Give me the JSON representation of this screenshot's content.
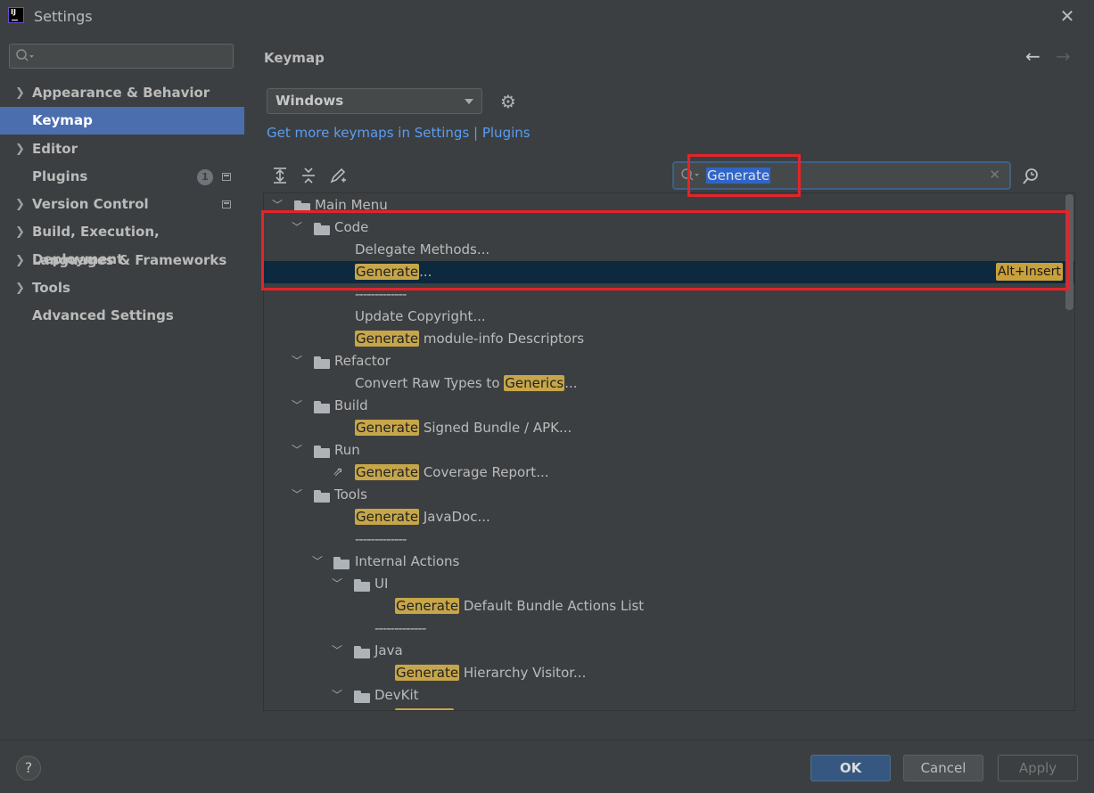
{
  "window": {
    "title": "Settings",
    "logo_text": "IJ"
  },
  "sidebar": {
    "search_placeholder": "",
    "items": [
      {
        "label": "Appearance & Behavior",
        "expandable": true
      },
      {
        "label": "Keymap",
        "selected": true
      },
      {
        "label": "Editor",
        "expandable": true
      },
      {
        "label": "Plugins",
        "badge": "1"
      },
      {
        "label": "Version Control",
        "expandable": true
      },
      {
        "label": "Build, Execution, Deployment",
        "expandable": true
      },
      {
        "label": "Languages & Frameworks",
        "expandable": true
      },
      {
        "label": "Tools",
        "expandable": true
      },
      {
        "label": "Advanced Settings"
      }
    ]
  },
  "main": {
    "title": "Keymap",
    "keymap_select": "Windows",
    "link_text": "Get more keymaps in Settings | Plugins",
    "filter_value": "Generate",
    "tree": [
      {
        "label": "Main Menu"
      },
      {
        "label": "Code"
      },
      {
        "label": "Delegate Methods..."
      },
      {
        "hl": "Generate",
        "rest": "...",
        "shortcut": "Alt+Insert"
      },
      {
        "label": "-------------"
      },
      {
        "label": "Update Copyright..."
      },
      {
        "hl": "Generate",
        "rest": " module-info Descriptors"
      },
      {
        "label": "Refactor"
      },
      {
        "pre": "Convert Raw Types to ",
        "hl": "Generics",
        "rest": "..."
      },
      {
        "label": "Build"
      },
      {
        "hl": "Generate",
        "rest": " Signed Bundle / APK..."
      },
      {
        "label": "Run"
      },
      {
        "hl": "Generate",
        "rest": " Coverage Report..."
      },
      {
        "label": "Tools"
      },
      {
        "hl": "Generate",
        "rest": " JavaDoc..."
      },
      {
        "label": "-------------"
      },
      {
        "label": "Internal Actions"
      },
      {
        "label": "UI"
      },
      {
        "hl": "Generate",
        "rest": " Default Bundle Actions List"
      },
      {
        "label": "-------------"
      },
      {
        "label": "Java"
      },
      {
        "hl": "Generate",
        "rest": " Hierarchy Visitor..."
      },
      {
        "label": "DevKit"
      }
    ]
  },
  "footer": {
    "help": "?",
    "ok": "OK",
    "cancel": "Cancel",
    "apply": "Apply"
  },
  "colors": {
    "accent": "#4b6eaf",
    "highlight": "#c7a64a",
    "annotation": "#e3242b"
  }
}
